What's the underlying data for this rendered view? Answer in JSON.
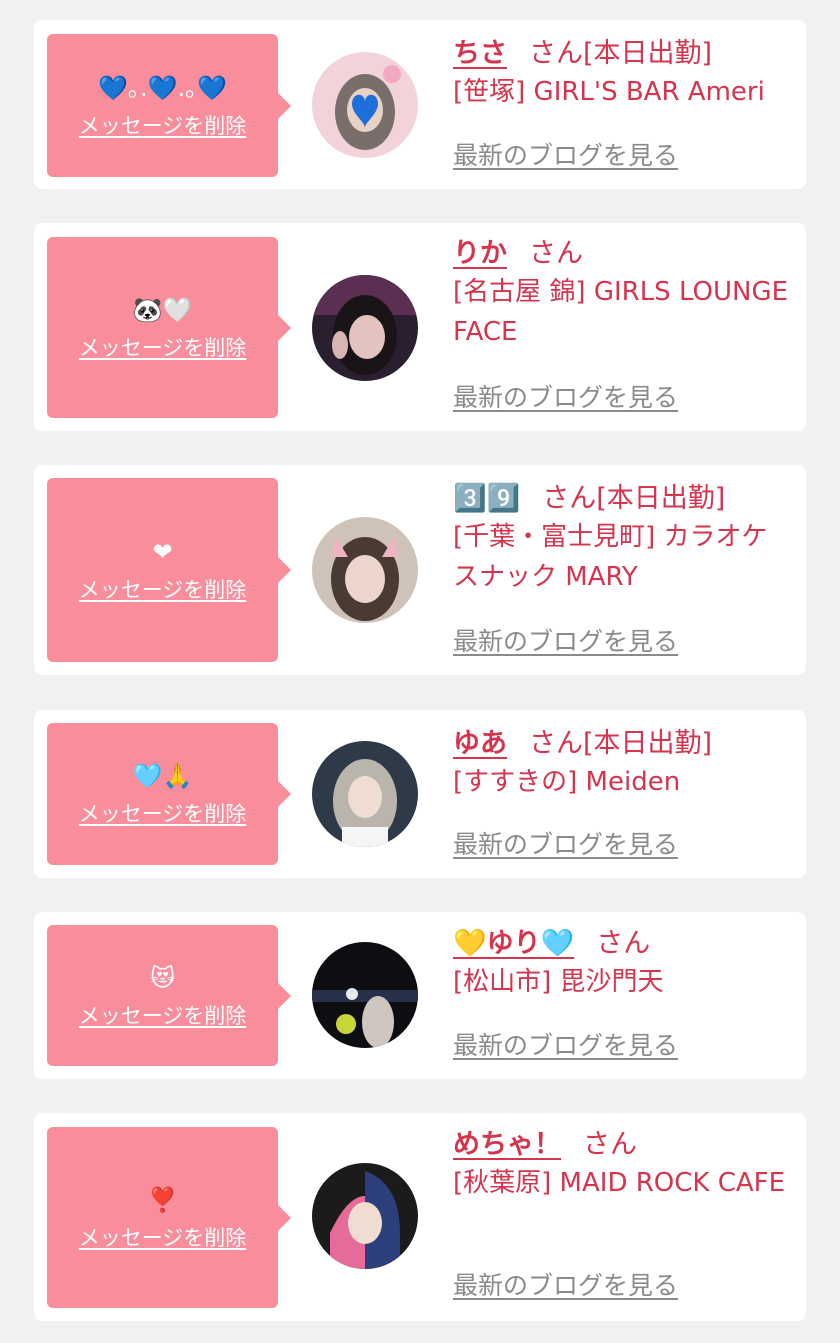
{
  "delete_label": "メッセージを削除",
  "blog_label": "最新のブログを見る",
  "san_label": "さん",
  "accent_color": "#d6334d",
  "bubble_color": "#f98d9c",
  "items": [
    {
      "message": "💙｡.💙.｡💙",
      "name": "ちさ",
      "status": "[本日出勤]",
      "shop": "[笹塚] GIRL'S BAR Ameri"
    },
    {
      "message": "🐼🤍",
      "name": "りか",
      "status": "",
      "shop": "[名古屋 錦] GIRLS LOUNGE FACE"
    },
    {
      "message": "❤",
      "name": "3️⃣9️⃣",
      "status": "[本日出勤]",
      "shop": "[千葉・富士見町] カラオケスナック MARY"
    },
    {
      "message": "🩵🙏",
      "name": "ゆあ",
      "status": "[本日出勤]",
      "shop": "[すすきの] Meiden"
    },
    {
      "message": "😻",
      "name": "💛ゆり🩵",
      "status": "",
      "shop": "[松山市] 毘沙門天"
    },
    {
      "message": "❣️",
      "name": "めちゃ！",
      "status": "",
      "shop": "[秋葉原] MAID ROCK CAFE"
    }
  ]
}
